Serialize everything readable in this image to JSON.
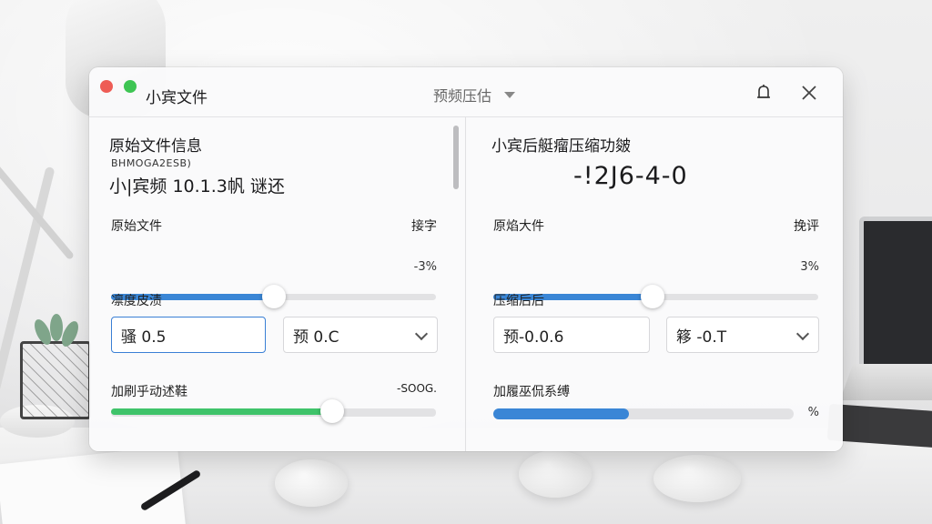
{
  "window": {
    "title": "小宾文件",
    "mode_select": "预频压估",
    "colors": {
      "blue": "#3a86d6",
      "green": "#3fc36a",
      "red_dot": "#ee5c55",
      "green_dot": "#3ec553"
    }
  },
  "left": {
    "heading": "原始文件信息",
    "sub_small": "BHMOGA2ESB)",
    "file_line": "小|宾频 10.1.3帆 谜还",
    "slider1": {
      "label": "原始文件",
      "right_label": "接字",
      "value_percent": 50,
      "pct_text": "-3%"
    },
    "section2_label": "凛度皮渍",
    "input_value": "骚 0.5",
    "select_value": "预 0.C",
    "slider2": {
      "label": "加刷乎动述鞋",
      "right_label": "-SOOG.",
      "value_percent": 68
    }
  },
  "right": {
    "heading": "小宾后艇瘤压缩功皴",
    "big_value": "-!2J6-4-0",
    "slider1": {
      "label": "原焰大件",
      "right_label": "挽评",
      "value_percent": 49,
      "pct_text": "3%"
    },
    "section2_label": "压缩后后",
    "input_value": "预-0.0.6",
    "select_value": "簃 -0.T",
    "progress": {
      "label": "加履巫侃系缚",
      "value_percent": 45,
      "pct_text": "%"
    }
  },
  "icons": {
    "bell": "bell-icon",
    "close": "close-icon",
    "caret": "caret-down-icon",
    "chevron": "chevron-down-icon"
  }
}
